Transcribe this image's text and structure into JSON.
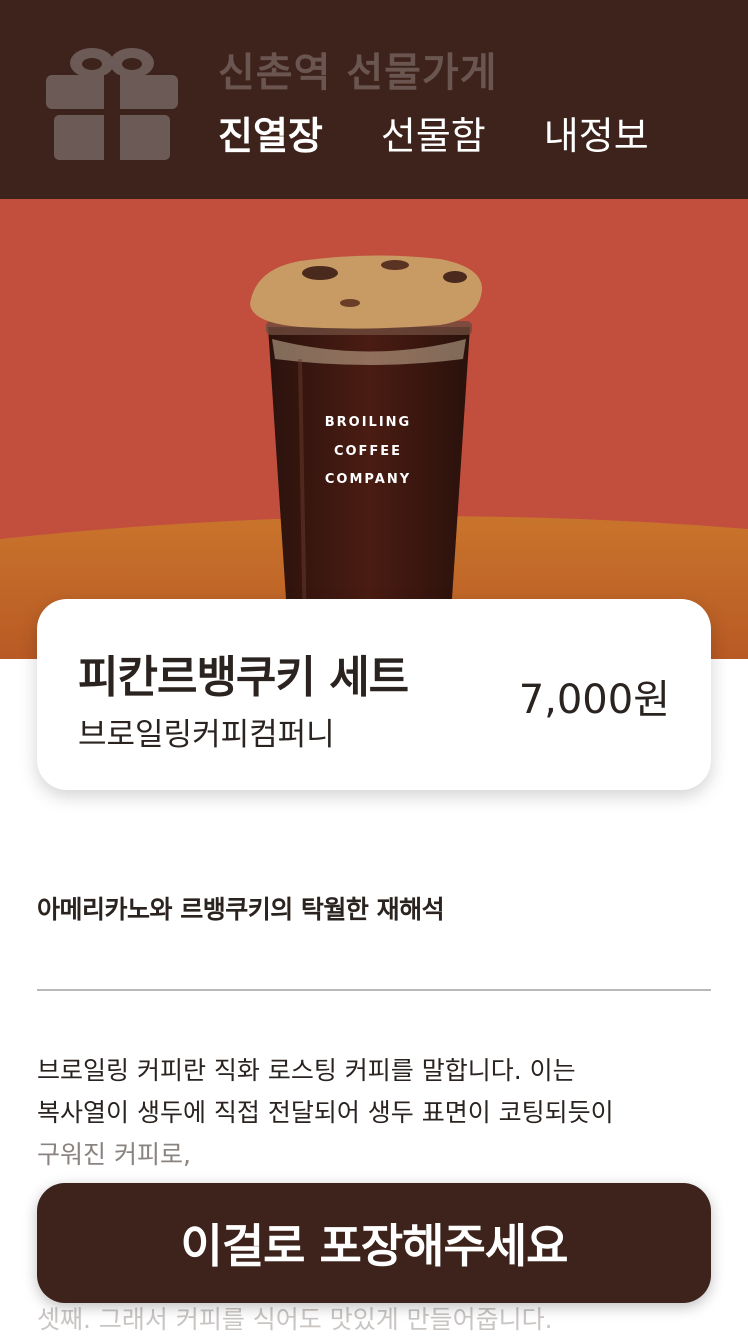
{
  "header": {
    "store_name": "신촌역 선물가게",
    "tabs": [
      {
        "label": "진열장",
        "active": true
      },
      {
        "label": "선물함",
        "active": false
      },
      {
        "label": "내정보",
        "active": false
      }
    ]
  },
  "hero": {
    "cup_text": [
      "BROILING",
      "COFFEE",
      "COMPANY"
    ]
  },
  "product": {
    "name": "피칸르뱅쿠키 세트",
    "brand": "브로일링커피컴퍼니",
    "price": "7,000원"
  },
  "headline": "아메리카노와 르뱅쿠키의 탁월한 재해석",
  "description": {
    "line1": "브로일링 커피란 직화 로스팅 커피를 말합니다. 이는",
    "line2": "복사열이 생두에 직접 전달되어 생두 표면이 코팅되듯이",
    "line3": "구워진 커피로,",
    "bottom": "셋째. 그래서 커피를 식어도 맛있게 만들어줍니다."
  },
  "cta": {
    "label": "이걸로 포장해주세요"
  },
  "colors": {
    "header_bg": "#3d231b",
    "hero_bg": "#c4503f",
    "cta_bg": "#3d231b"
  }
}
